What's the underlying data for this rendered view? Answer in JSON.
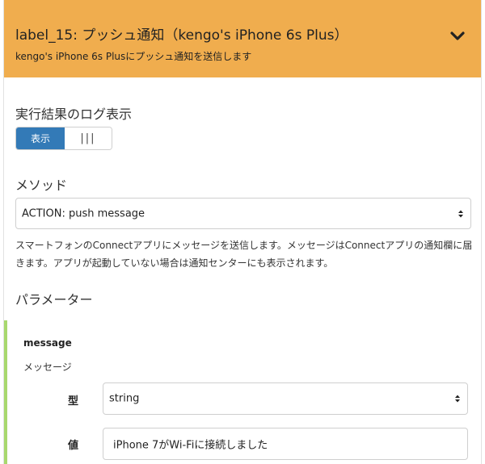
{
  "header": {
    "title": "label_15: プッシュ通知（kengo's iPhone 6s Plus）",
    "subtitle": "kengo's iPhone 6s Plusにプッシュ通知を送信します",
    "toggle_icon": "chevron-down-icon",
    "color": "#f0ad4e"
  },
  "log": {
    "label": "実行結果のログ表示",
    "on_label": "表示",
    "off_label": "|||",
    "accent": "#337ab7"
  },
  "method": {
    "label": "メソッド",
    "selected": "ACTION: push message",
    "description": "スマートフォンのConnectアプリにメッセージを送信します。メッセージはConnectアプリの通知欄に届きます。アプリが起動していない場合は通知センターにも表示されます。"
  },
  "parameters": {
    "label": "パラメーター",
    "accent": "#a8d86e",
    "items": [
      {
        "name": "message",
        "description": "メッセージ",
        "type_label": "型",
        "type_value": "string",
        "value_label": "値",
        "value": "iPhone 7がWi-Fiに接続しました"
      }
    ]
  }
}
